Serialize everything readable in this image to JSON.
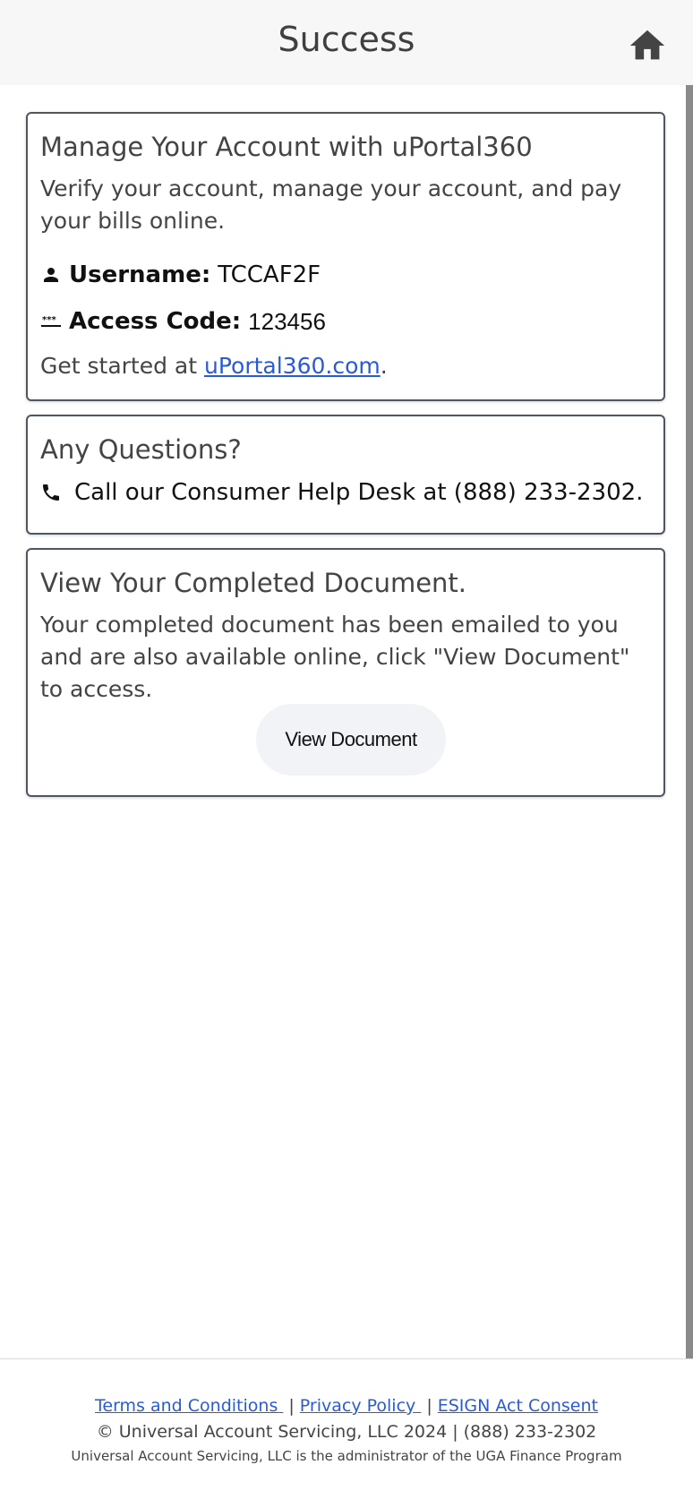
{
  "header": {
    "title": "Success",
    "home_icon": "home-icon"
  },
  "account_card": {
    "title": "Manage Your Account with uPortal360",
    "description": "Verify your account, manage your account, and pay your bills online.",
    "username_label": "Username:",
    "username_value": "TCCAF2F",
    "access_code_label": "Access Code:",
    "access_code_value": "123456",
    "get_started_prefix": "Get started at ",
    "portal_link": "uPortal360.com",
    "get_started_suffix": ".",
    "icons": [
      "person-icon",
      "password-icon"
    ]
  },
  "questions_card": {
    "title": "Any Questions?",
    "help_text": "Call our Consumer Help Desk at (888) 233-2302.",
    "icon": "phone-icon"
  },
  "document_card": {
    "title": "View Your Completed Document.",
    "description": "Your completed document has been emailed to you and are also available online, click \"View Document\" to access.",
    "button_label": "View Document"
  },
  "footer": {
    "terms_link": "Terms and Conditions ",
    "privacy_link": "Privacy Policy ",
    "esign_link": "ESIGN Act Consent",
    "separator": "|",
    "copyright": "© Universal Account Servicing, LLC 2024 | (888) 233-2302",
    "admin_note": "Universal Account Servicing, LLC is the administrator of the UGA Finance Program"
  },
  "colors": {
    "link": "#2a5bd7",
    "card_border": "#4d5663",
    "header_bg": "#f7f7f7",
    "button_bg": "#f1f3f7"
  }
}
